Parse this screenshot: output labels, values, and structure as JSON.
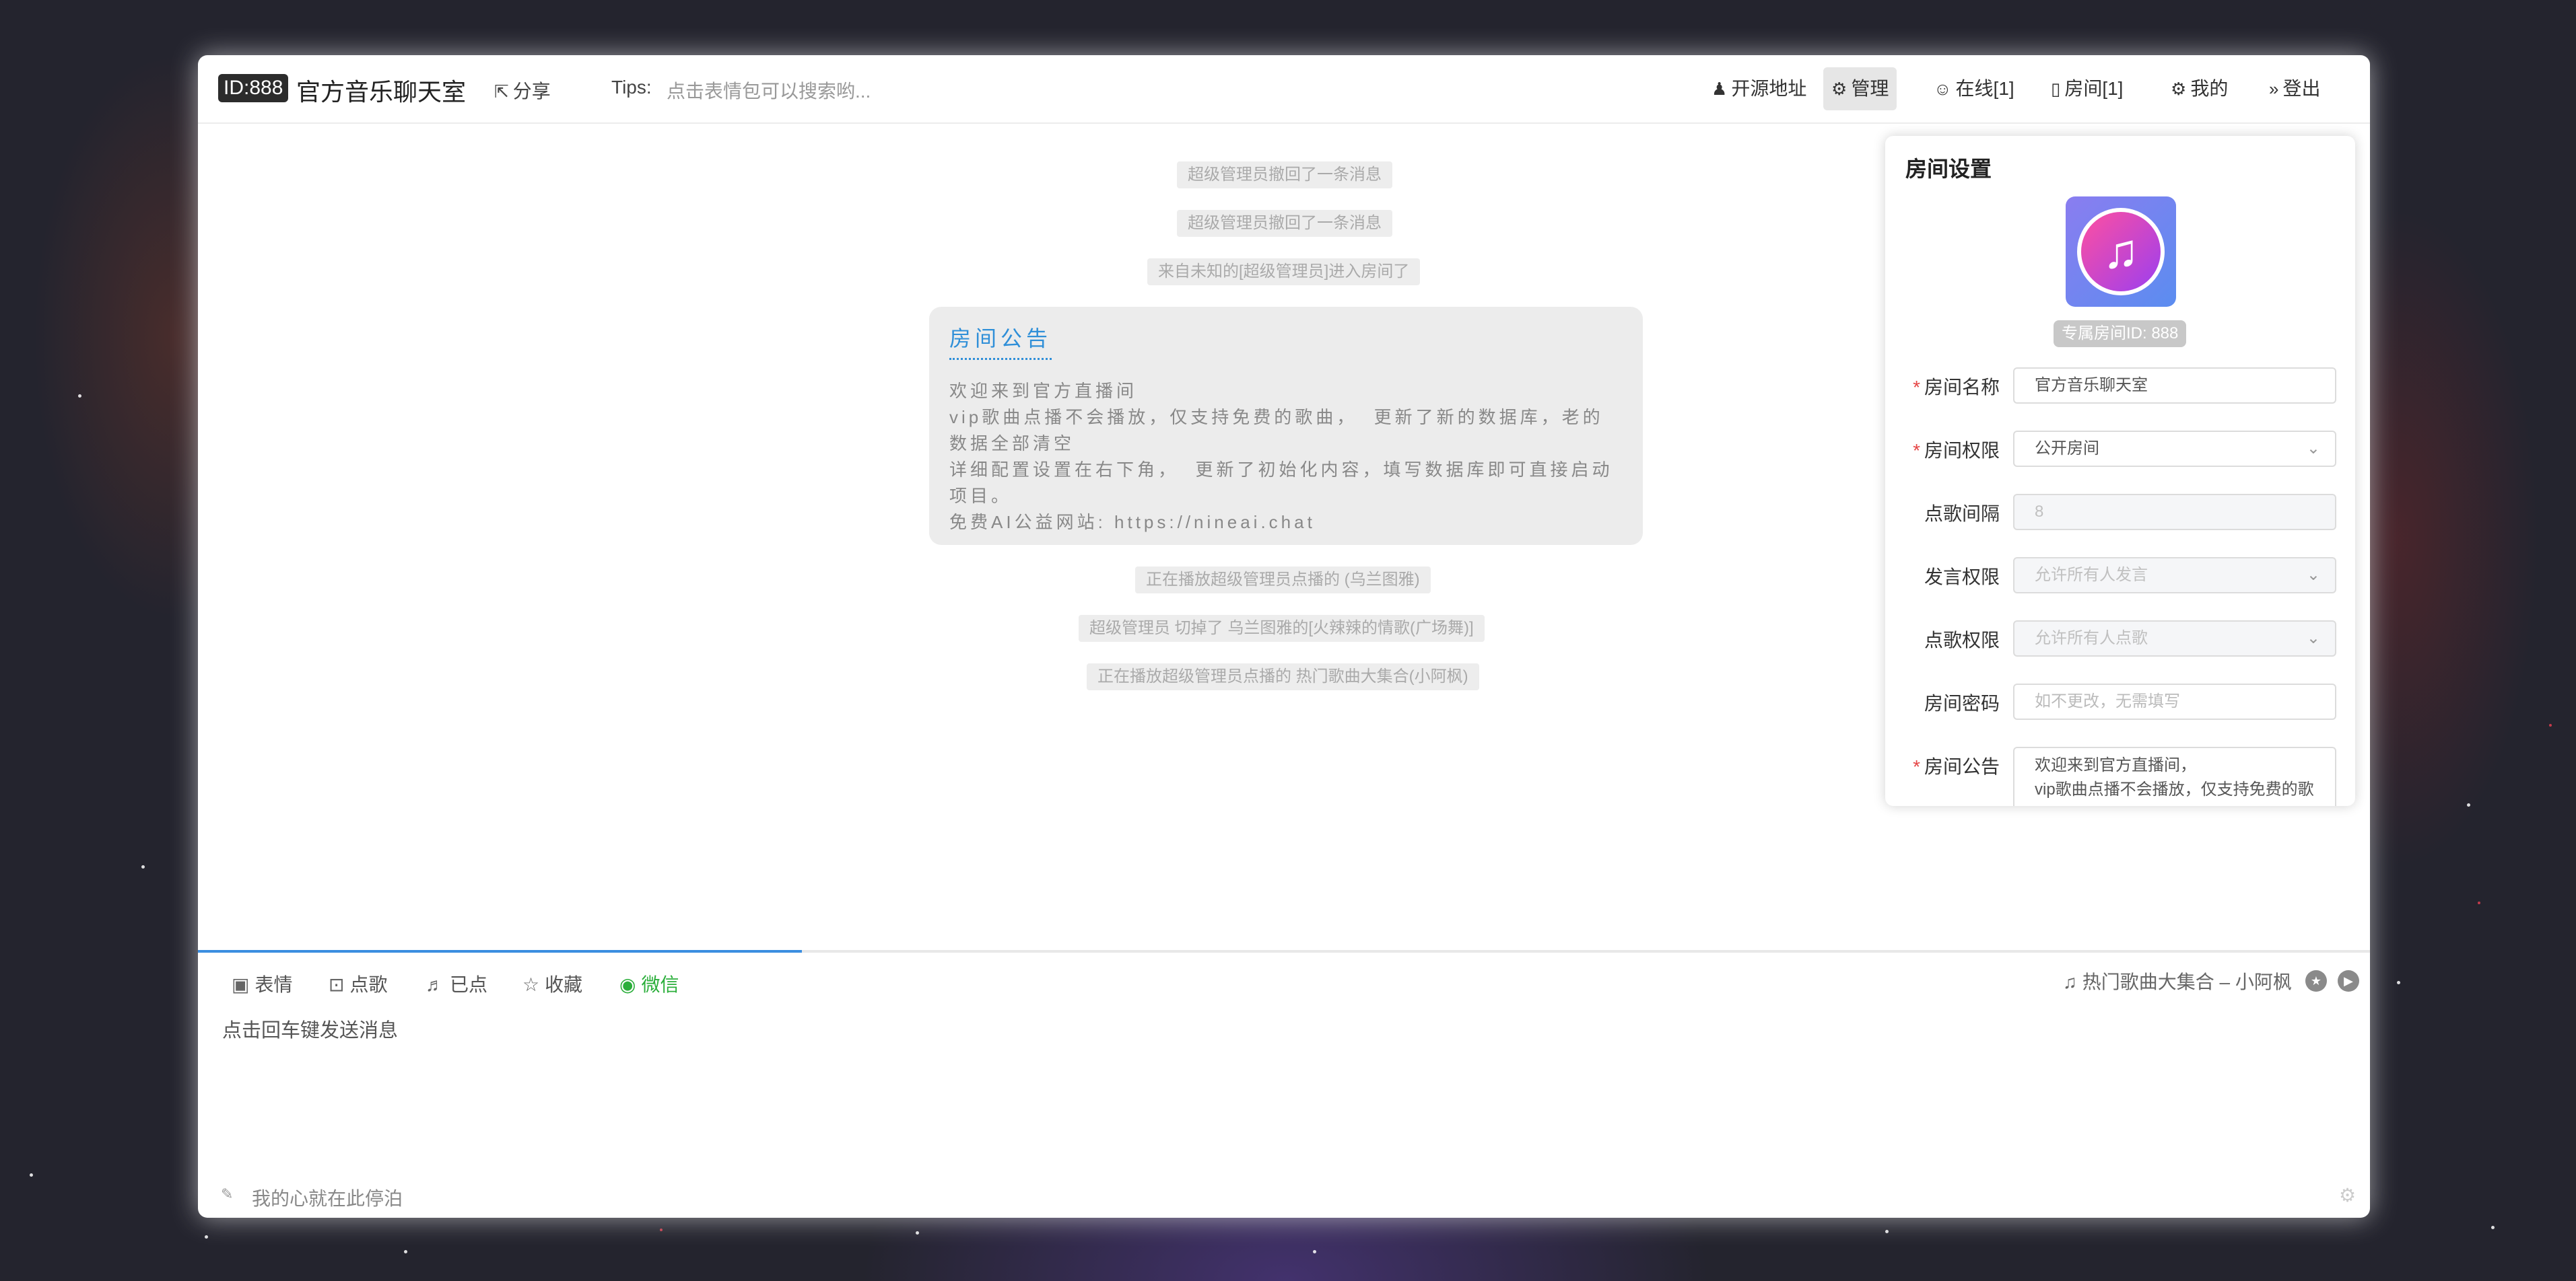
{
  "header": {
    "id_badge": "ID:888",
    "room_title": "官方音乐聊天室",
    "share_label": "分享",
    "tips_label": "Tips:",
    "tips_text": "点击表情包可以搜索哟...",
    "nav": {
      "opensource": "开源地址",
      "manage": "管理",
      "online": "在线[1]",
      "rooms": "房间[1]",
      "mine": "我的",
      "logout": "登出"
    }
  },
  "chat": {
    "system_messages": [
      "超级管理员撤回了一条消息",
      "超级管理员撤回了一条消息",
      "来自未知的[超级管理员]进入房间了",
      "正在播放超级管理员点播的 (乌兰图雅)",
      "超级管理员 切掉了 乌兰图雅的[火辣辣的情歌(广场舞)]",
      "正在播放超级管理员点播的 热门歌曲大集合(小阿枫)"
    ],
    "notice": {
      "title": "房间公告",
      "body": "欢迎来到官方直播间\nvip歌曲点播不会播放，仅支持免费的歌曲，  更新了新的数据库，老的数据全部清空\n详细配置设置在右下角，  更新了初始化内容，填写数据库即可直接启动项目。\n免费AI公益网站: https://nineai.chat"
    }
  },
  "settings": {
    "title": "房间设置",
    "room_id_badge": "专属房间ID: 888",
    "fields": {
      "name": {
        "label": "房间名称",
        "value": "官方音乐聊天室"
      },
      "permission": {
        "label": "房间权限",
        "value": "公开房间"
      },
      "interval": {
        "label": "点歌间隔",
        "value": "8"
      },
      "speak": {
        "label": "发言权限",
        "value": "允许所有人发言"
      },
      "song": {
        "label": "点歌权限",
        "value": "允许所有人点歌"
      },
      "password": {
        "label": "房间密码",
        "placeholder": "如不更改，无需填写"
      },
      "notice": {
        "label": "房间公告",
        "value": "欢迎来到官方直播间，\nvip歌曲点播不会播放，仅支持免费的歌"
      }
    }
  },
  "toolbar": {
    "emoji": "表情",
    "order_song": "点歌",
    "ordered": "已点",
    "favorites": "收藏",
    "wechat": "微信",
    "now_playing": "热门歌曲大集合 – 小阿枫",
    "progress": 0.278
  },
  "input": {
    "placeholder": "点击回车键发送消息"
  },
  "footer": {
    "signature": "我的心就在此停泊"
  },
  "colors": {
    "accent": "#3b8ee0",
    "wechat": "#2aae3a",
    "required": "#e54545"
  }
}
